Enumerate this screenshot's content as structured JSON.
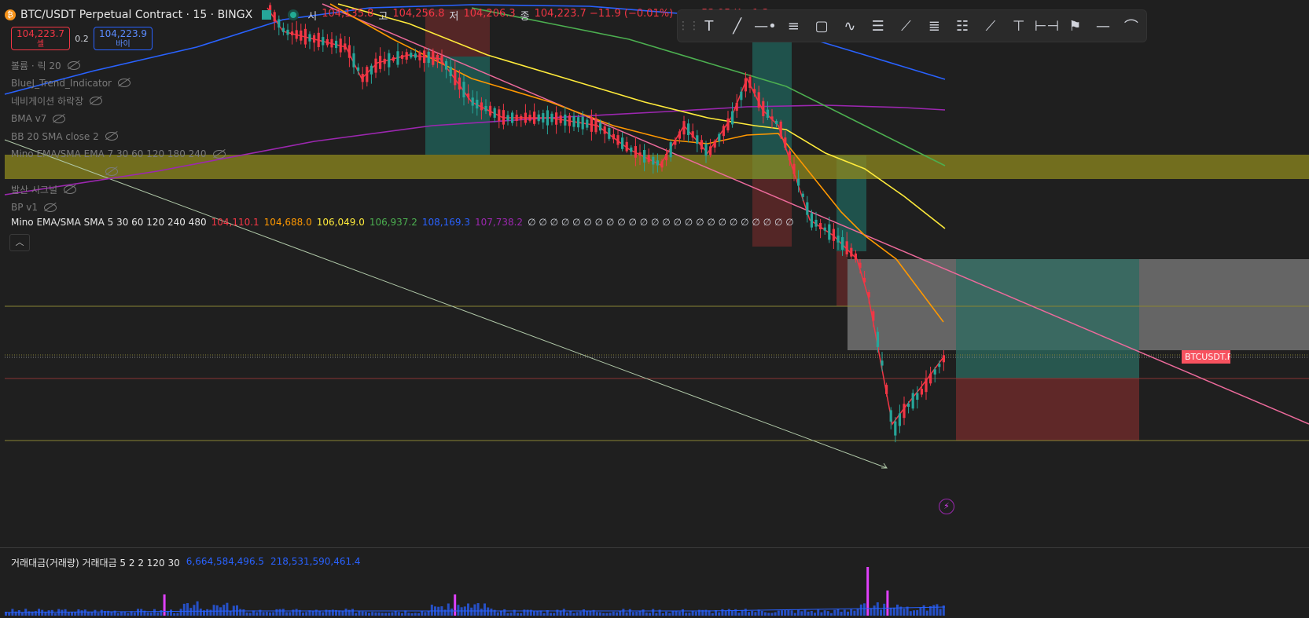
{
  "header": {
    "coin_glyph": "₿",
    "symbol": "BTC/USDT Perpetual Contract · 15 · BINGX",
    "ohlc": [
      {
        "k": "시",
        "v": "104,135.8"
      },
      {
        "k": "고",
        "v": "104,256.8"
      },
      {
        "k": "저",
        "v": "104,206.3"
      },
      {
        "k": "종",
        "v": "104,223.7  −11.9 (−0.01%)"
      },
      {
        "k": "볼륨",
        "v": "53.95 K  −1,3"
      }
    ]
  },
  "trade": {
    "sell_price": "104,223.7",
    "sell_label": "셀",
    "spread": "0.2",
    "buy_price": "104,223.9",
    "buy_label": "바이"
  },
  "indicators": [
    "볼륨 · 릭 20",
    "BlueJ_Trend_Indicator",
    "네비게이션 하락장",
    "BMA v7",
    "BB 20 SMA close 2",
    "Mino EMA/SMA EMA 7 30 60 120 180 240",
    "",
    "발산 시그널",
    "BP v1"
  ],
  "mino_legend": {
    "name": "Mino EMA/SMA SMA 5 30 60 120 240 480",
    "values": [
      {
        "v": "104,110.1",
        "color": "#f23645"
      },
      {
        "v": "104,688.0",
        "color": "#ff9800"
      },
      {
        "v": "106,049.0",
        "color": "#ffeb3b"
      },
      {
        "v": "106,937.2",
        "color": "#4caf50"
      },
      {
        "v": "108,169.3",
        "color": "#2962ff"
      },
      {
        "v": "107,738.2",
        "color": "#9c27b0"
      }
    ],
    "empties": "∅ ∅ ∅ ∅ ∅ ∅ ∅ ∅ ∅ ∅ ∅ ∅ ∅ ∅ ∅ ∅ ∅ ∅ ∅ ∅ ∅ ∅ ∅ ∅"
  },
  "collapse_glyph": "︿",
  "toolbar": {
    "grip": "⋮⋮",
    "tools": [
      {
        "name": "text-tool",
        "glyph": "T"
      },
      {
        "name": "trendline-tool",
        "glyph": "╱"
      },
      {
        "name": "horizontal-ray-tool",
        "glyph": "—•"
      },
      {
        "name": "fib-tool",
        "glyph": "≡"
      },
      {
        "name": "rectangle-tool",
        "glyph": "▢"
      },
      {
        "name": "path-tool",
        "glyph": "∿"
      },
      {
        "name": "fib-levels-tool",
        "glyph": "☰"
      },
      {
        "name": "gann-tool",
        "glyph": "⟋"
      },
      {
        "name": "channel-tool",
        "glyph": "≣"
      },
      {
        "name": "fib-extension-tool",
        "glyph": "☷"
      },
      {
        "name": "ray-tool",
        "glyph": "⟋"
      },
      {
        "name": "price-range-tool",
        "glyph": "⊤"
      },
      {
        "name": "date-range-tool",
        "glyph": "⊢⊣"
      },
      {
        "name": "flag-tool",
        "glyph": "⚑"
      },
      {
        "name": "horizontal-line-tool",
        "glyph": "—"
      },
      {
        "name": "curve-tool",
        "glyph": "⌒"
      }
    ]
  },
  "price_tag": "BTCUSDT.P",
  "bolt_glyph": "⚡",
  "colors": {
    "up": "#26a69a",
    "down": "#f23645",
    "highlight_band": "#8f8a1f"
  },
  "volume": {
    "name": "거래대금(거래량) 거래대금 5 2 2 120 30",
    "v1": "6,664,584,496.5",
    "v2": "218,531,590,461.4"
  }
}
